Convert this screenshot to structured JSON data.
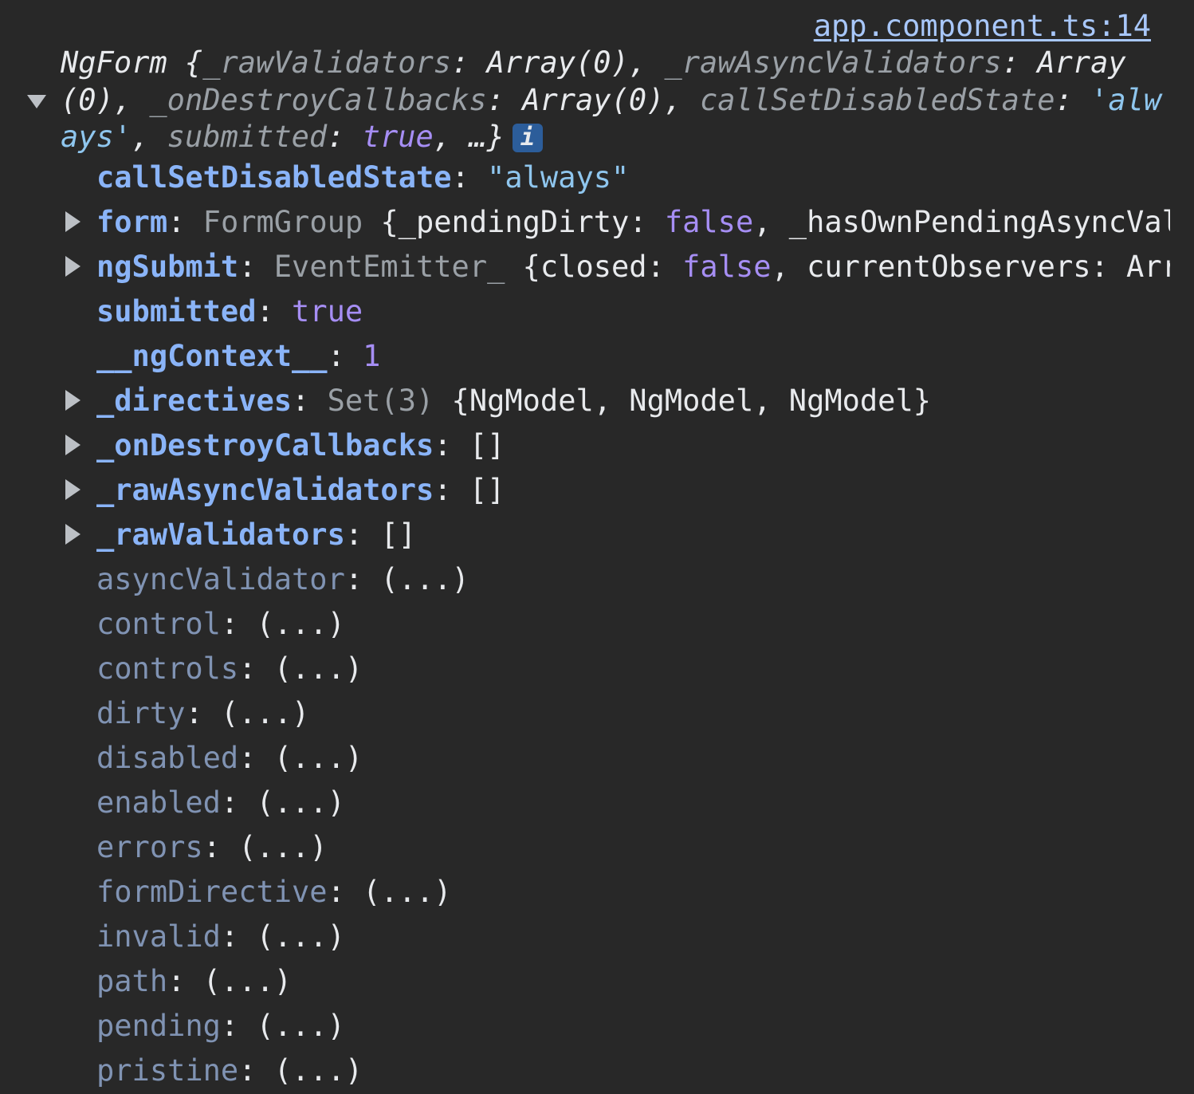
{
  "source": {
    "link": "app.component.ts:14"
  },
  "header": {
    "prefix": "NgForm {",
    "items": [
      {
        "k": "_rawValidators",
        "v": "Array(0)",
        "vtype": "plain",
        "sep": ", "
      },
      {
        "k": "_rawAsyncValidators",
        "v": "Array(0)",
        "vtype": "plain",
        "sep": ", "
      },
      {
        "k": "_onDestroyCallbacks",
        "v": "Array(0)",
        "vtype": "plain",
        "sep": ", "
      },
      {
        "k": "callSetDisabledState",
        "v": "'always'",
        "vtype": "str",
        "sep": ", "
      },
      {
        "k": "submitted",
        "v": "true",
        "vtype": "kw",
        "sep": ", "
      }
    ],
    "suffix": "…}",
    "info_glyph": "i"
  },
  "properties": [
    {
      "name": "callSetDisabledState",
      "expandable": false,
      "lazy": false,
      "value": [
        {
          "t": "\"always\"",
          "c": "str"
        }
      ]
    },
    {
      "name": "form",
      "expandable": true,
      "lazy": false,
      "value": [
        {
          "t": "FormGroup ",
          "c": "val-cls"
        },
        {
          "t": "{_pendingDirty: ",
          "c": "val-plain"
        },
        {
          "t": "false",
          "c": "kw"
        },
        {
          "t": ", _hasOwnPendingAsyncValidator",
          "c": "val-plain"
        }
      ]
    },
    {
      "name": "ngSubmit",
      "expandable": true,
      "lazy": false,
      "value": [
        {
          "t": "EventEmitter_ ",
          "c": "val-cls"
        },
        {
          "t": "{closed: ",
          "c": "val-plain"
        },
        {
          "t": "false",
          "c": "kw"
        },
        {
          "t": ", currentObservers: Array",
          "c": "val-plain"
        }
      ]
    },
    {
      "name": "submitted",
      "expandable": false,
      "lazy": false,
      "value": [
        {
          "t": "true",
          "c": "kw"
        }
      ]
    },
    {
      "name": "__ngContext__",
      "expandable": false,
      "lazy": false,
      "value": [
        {
          "t": "1",
          "c": "num"
        }
      ]
    },
    {
      "name": "_directives",
      "expandable": true,
      "lazy": false,
      "value": [
        {
          "t": "Set(3) ",
          "c": "val-cls"
        },
        {
          "t": "{NgModel, NgModel, NgModel}",
          "c": "val-plain"
        }
      ]
    },
    {
      "name": "_onDestroyCallbacks",
      "expandable": true,
      "lazy": false,
      "value": [
        {
          "t": "[]",
          "c": "val-plain"
        }
      ]
    },
    {
      "name": "_rawAsyncValidators",
      "expandable": true,
      "lazy": false,
      "value": [
        {
          "t": "[]",
          "c": "val-plain"
        }
      ]
    },
    {
      "name": "_rawValidators",
      "expandable": true,
      "lazy": false,
      "value": [
        {
          "t": "[]",
          "c": "val-plain"
        }
      ]
    },
    {
      "name": "asyncValidator",
      "expandable": false,
      "lazy": true,
      "value": [
        {
          "t": "(...)",
          "c": "val-plain"
        }
      ]
    },
    {
      "name": "control",
      "expandable": false,
      "lazy": true,
      "value": [
        {
          "t": "(...)",
          "c": "val-plain"
        }
      ]
    },
    {
      "name": "controls",
      "expandable": false,
      "lazy": true,
      "value": [
        {
          "t": "(...)",
          "c": "val-plain"
        }
      ]
    },
    {
      "name": "dirty",
      "expandable": false,
      "lazy": true,
      "value": [
        {
          "t": "(...)",
          "c": "val-plain"
        }
      ]
    },
    {
      "name": "disabled",
      "expandable": false,
      "lazy": true,
      "value": [
        {
          "t": "(...)",
          "c": "val-plain"
        }
      ]
    },
    {
      "name": "enabled",
      "expandable": false,
      "lazy": true,
      "value": [
        {
          "t": "(...)",
          "c": "val-plain"
        }
      ]
    },
    {
      "name": "errors",
      "expandable": false,
      "lazy": true,
      "value": [
        {
          "t": "(...)",
          "c": "val-plain"
        }
      ]
    },
    {
      "name": "formDirective",
      "expandable": false,
      "lazy": true,
      "value": [
        {
          "t": "(...)",
          "c": "val-plain"
        }
      ]
    },
    {
      "name": "invalid",
      "expandable": false,
      "lazy": true,
      "value": [
        {
          "t": "(...)",
          "c": "val-plain"
        }
      ]
    },
    {
      "name": "path",
      "expandable": false,
      "lazy": true,
      "value": [
        {
          "t": "(...)",
          "c": "val-plain"
        }
      ]
    },
    {
      "name": "pending",
      "expandable": false,
      "lazy": true,
      "value": [
        {
          "t": "(...)",
          "c": "val-plain"
        }
      ]
    },
    {
      "name": "pristine",
      "expandable": false,
      "lazy": true,
      "value": [
        {
          "t": "(...)",
          "c": "val-plain"
        }
      ]
    }
  ],
  "colors": {
    "background": "#282828",
    "property_name": "#8ab4f8",
    "lazy_property_name": "#8093b3",
    "string": "#8fc6ee",
    "keyword": "#a68ef4",
    "class_name": "#9aa0a6",
    "link": "#a8c7fa"
  }
}
